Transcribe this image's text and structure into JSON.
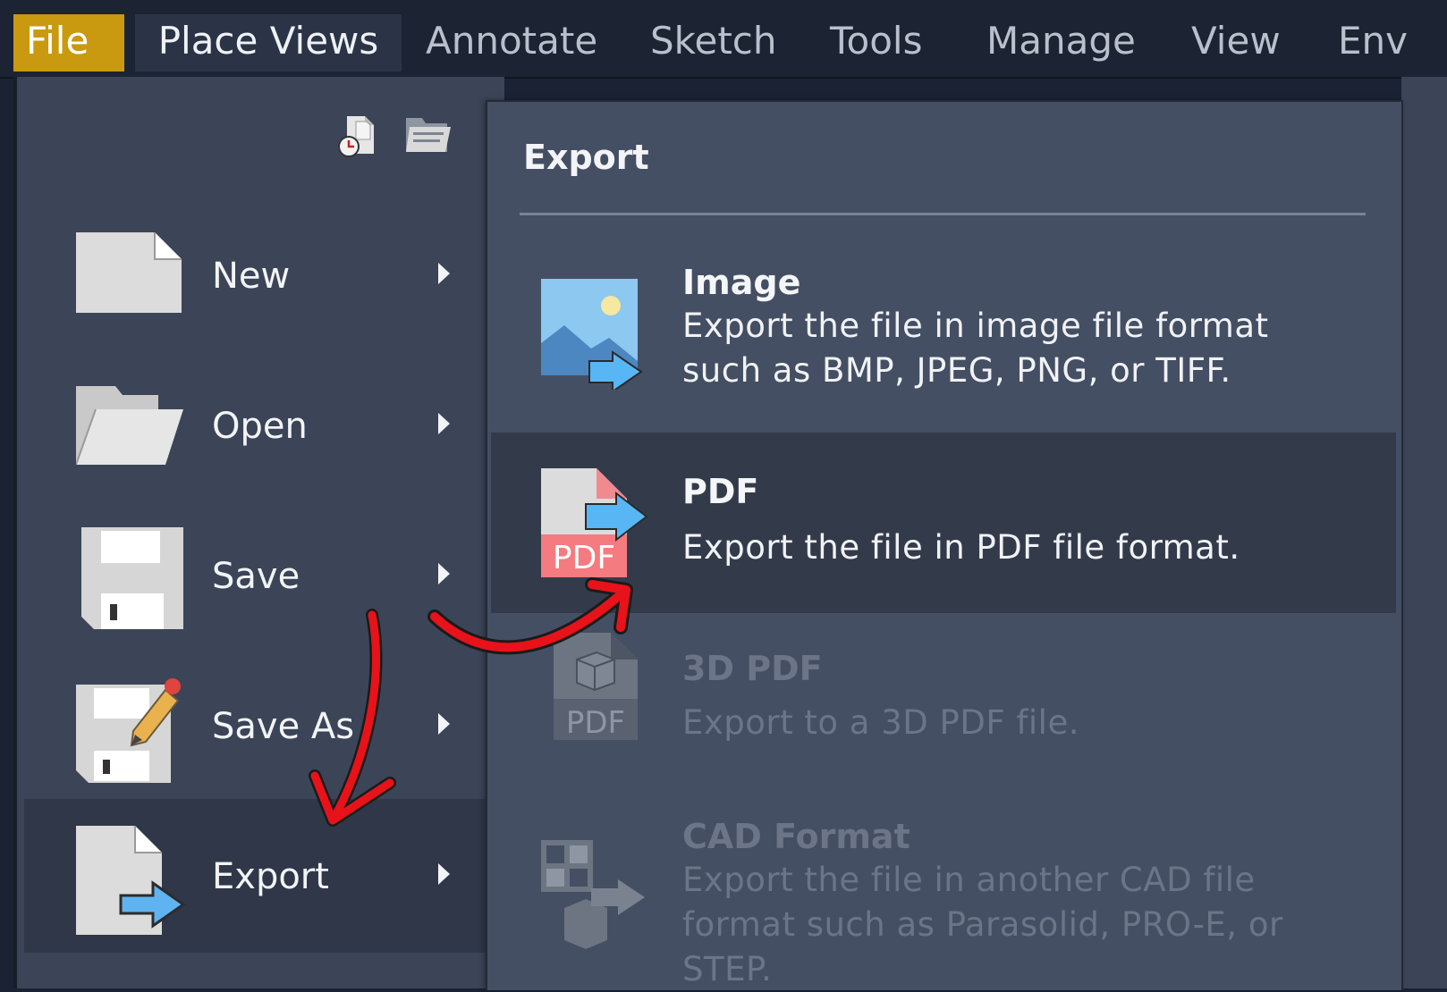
{
  "ribbon": {
    "tabs": [
      {
        "label": "File"
      },
      {
        "label": "Place Views"
      },
      {
        "label": "Annotate"
      },
      {
        "label": "Sketch"
      },
      {
        "label": "Tools"
      },
      {
        "label": "Manage"
      },
      {
        "label": "View"
      },
      {
        "label": "Env"
      }
    ]
  },
  "file_menu": {
    "quick_icons": [
      "recent-documents-icon",
      "open-folder-icon"
    ],
    "items": [
      {
        "label": "New",
        "icon": "new-document-icon"
      },
      {
        "label": "Open",
        "icon": "open-folder-icon"
      },
      {
        "label": "Save",
        "icon": "floppy-disk-icon"
      },
      {
        "label": "Save As",
        "icon": "save-as-pencil-icon"
      },
      {
        "label": "Export",
        "icon": "export-document-icon",
        "selected": true
      }
    ]
  },
  "export_menu": {
    "title": "Export",
    "items": [
      {
        "title": "Image",
        "description": "Export the file in image file format such as BMP, JPEG, PNG, or TIFF.",
        "icon": "image-export-icon",
        "enabled": true
      },
      {
        "title": "PDF",
        "description": "Export the file in PDF file format.",
        "icon": "pdf-export-icon",
        "icon_text": "PDF",
        "enabled": true,
        "highlighted": true
      },
      {
        "title": "3D PDF",
        "description": "Export to a 3D PDF file.",
        "icon": "3d-pdf-icon",
        "icon_text": "PDF",
        "enabled": false
      },
      {
        "title": "CAD Format",
        "description": "Export the file in another CAD file format such as Parasolid, PRO-E, or STEP.",
        "icon": "cad-format-icon",
        "enabled": false
      }
    ]
  },
  "colors": {
    "file_tab": "#c99a10",
    "menu_bg": "#3c4557",
    "submenu_bg": "#454f63",
    "highlight": "#333b4b",
    "annotation_arrow": "#e8121a"
  }
}
